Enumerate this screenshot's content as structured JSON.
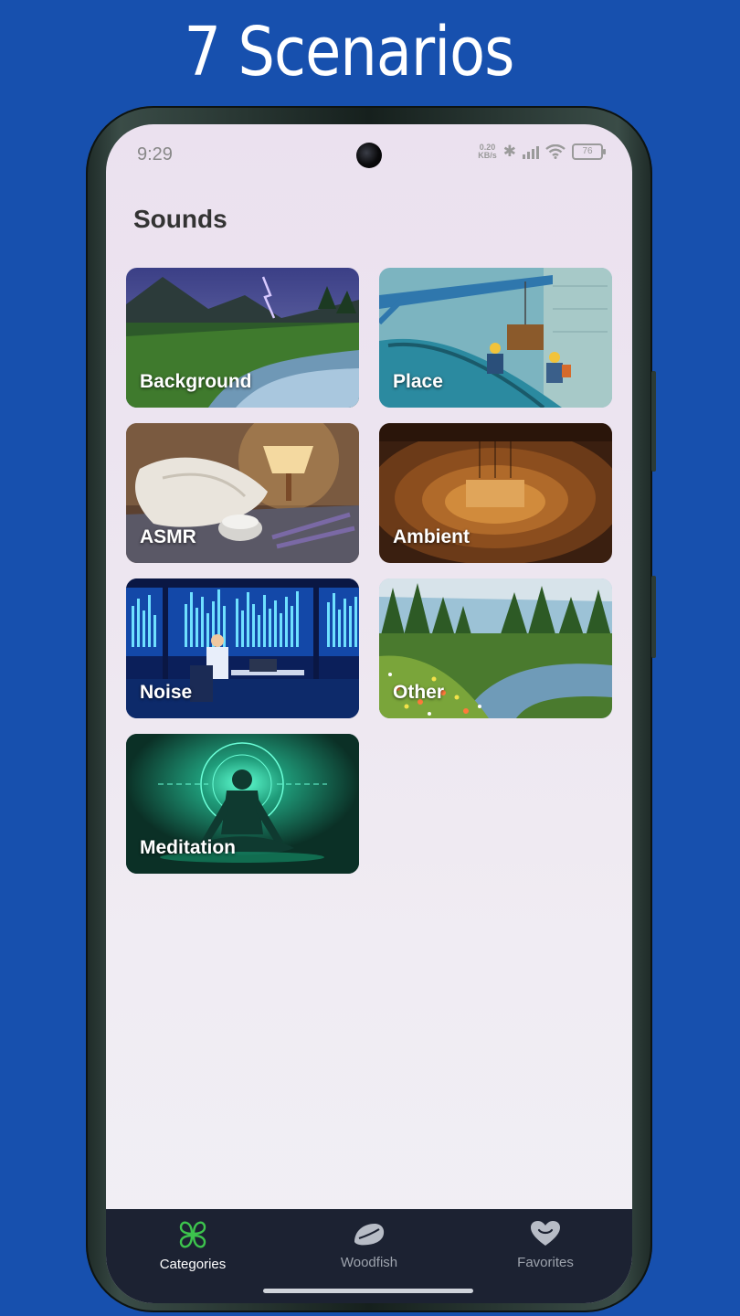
{
  "promo": {
    "title": "7 Scenarios"
  },
  "status_bar": {
    "time": "9:29",
    "net_speed_value": "0.20",
    "net_speed_unit": "KB/s",
    "battery": "76"
  },
  "page": {
    "title": "Sounds"
  },
  "categories": [
    {
      "label": "Background"
    },
    {
      "label": "Place"
    },
    {
      "label": "ASMR"
    },
    {
      "label": "Ambient"
    },
    {
      "label": "Noise"
    },
    {
      "label": "Other"
    },
    {
      "label": "Meditation"
    }
  ],
  "bottom_nav": {
    "items": [
      {
        "label": "Categories",
        "icon": "clover-icon",
        "active": true
      },
      {
        "label": "Woodfish",
        "icon": "woodfish-icon",
        "active": false
      },
      {
        "label": "Favorites",
        "icon": "heart-icon",
        "active": false
      }
    ]
  },
  "colors": {
    "background": "#1750ae",
    "nav_background": "#1c2232",
    "accent": "#3dc44d"
  }
}
